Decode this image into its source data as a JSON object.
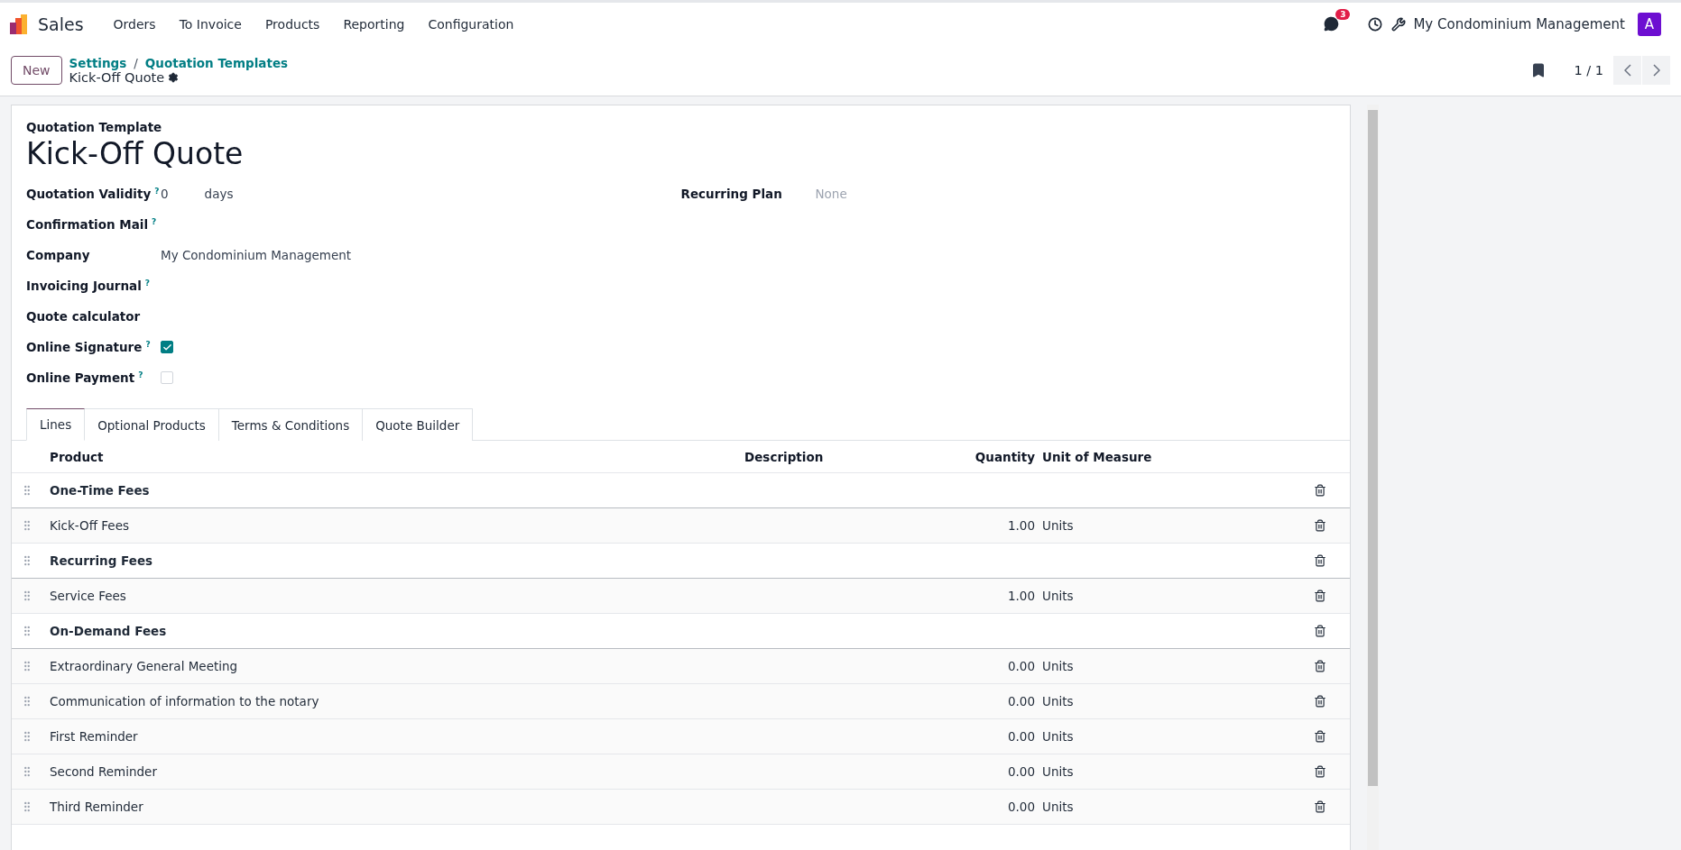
{
  "navbar": {
    "app": "Sales",
    "menu": [
      "Orders",
      "To Invoice",
      "Products",
      "Reporting",
      "Configuration"
    ],
    "message_count": "3",
    "company": "My Condominium Management",
    "avatar": "A"
  },
  "control_panel": {
    "new_button": "New",
    "breadcrumbs": [
      "Settings",
      "Quotation Templates"
    ],
    "separator": "/",
    "record": "Kick-Off Quote",
    "pager": "1 / 1"
  },
  "form": {
    "caption": "Quotation Template",
    "title": "Kick-Off Quote",
    "left_fields": [
      {
        "kind": "text",
        "label": "Quotation Validity",
        "help": "?",
        "value": "0",
        "suffix": "days"
      },
      {
        "kind": "text",
        "label": "Confirmation Mail",
        "help": "?"
      },
      {
        "kind": "text",
        "label": "Company",
        "value": "My Condominium Management"
      },
      {
        "kind": "text",
        "label": "Invoicing Journal",
        "help": "?"
      },
      {
        "kind": "text",
        "label": "Quote calculator"
      },
      {
        "kind": "checkbox",
        "label": "Online Signature",
        "help": "?",
        "checked": true
      },
      {
        "kind": "checkbox",
        "label": "Online Payment",
        "help": "?",
        "checked": false
      }
    ],
    "right_fields": [
      {
        "kind": "text",
        "label": "Recurring Plan",
        "placeholder": "None"
      }
    ]
  },
  "tabs": [
    {
      "label": "Lines",
      "selected": true
    },
    {
      "label": "Optional Products",
      "selected": false
    },
    {
      "label": "Terms & Conditions",
      "selected": false
    },
    {
      "label": "Quote Builder",
      "selected": false
    }
  ],
  "table": {
    "columns": [
      "Product",
      "Description",
      "Quantity",
      "Unit of Measure"
    ],
    "rows": [
      {
        "kind": "section",
        "product": "One-Time Fees"
      },
      {
        "kind": "line",
        "product": "Kick-Off Fees",
        "quantity": "1.00",
        "unit": "Units"
      },
      {
        "kind": "section",
        "product": "Recurring Fees"
      },
      {
        "kind": "line",
        "product": "Service Fees",
        "quantity": "1.00",
        "unit": "Units"
      },
      {
        "kind": "section",
        "product": "On-Demand Fees"
      },
      {
        "kind": "line",
        "product": "Extraordinary General Meeting",
        "quantity": "0.00",
        "unit": "Units"
      },
      {
        "kind": "line",
        "product": "Communication of information to the notary",
        "quantity": "0.00",
        "unit": "Units"
      },
      {
        "kind": "line",
        "product": "First Reminder",
        "quantity": "0.00",
        "unit": "Units"
      },
      {
        "kind": "line",
        "product": "Second Reminder",
        "quantity": "0.00",
        "unit": "Units"
      },
      {
        "kind": "line",
        "product": "Third Reminder",
        "quantity": "0.00",
        "unit": "Units"
      }
    ]
  }
}
